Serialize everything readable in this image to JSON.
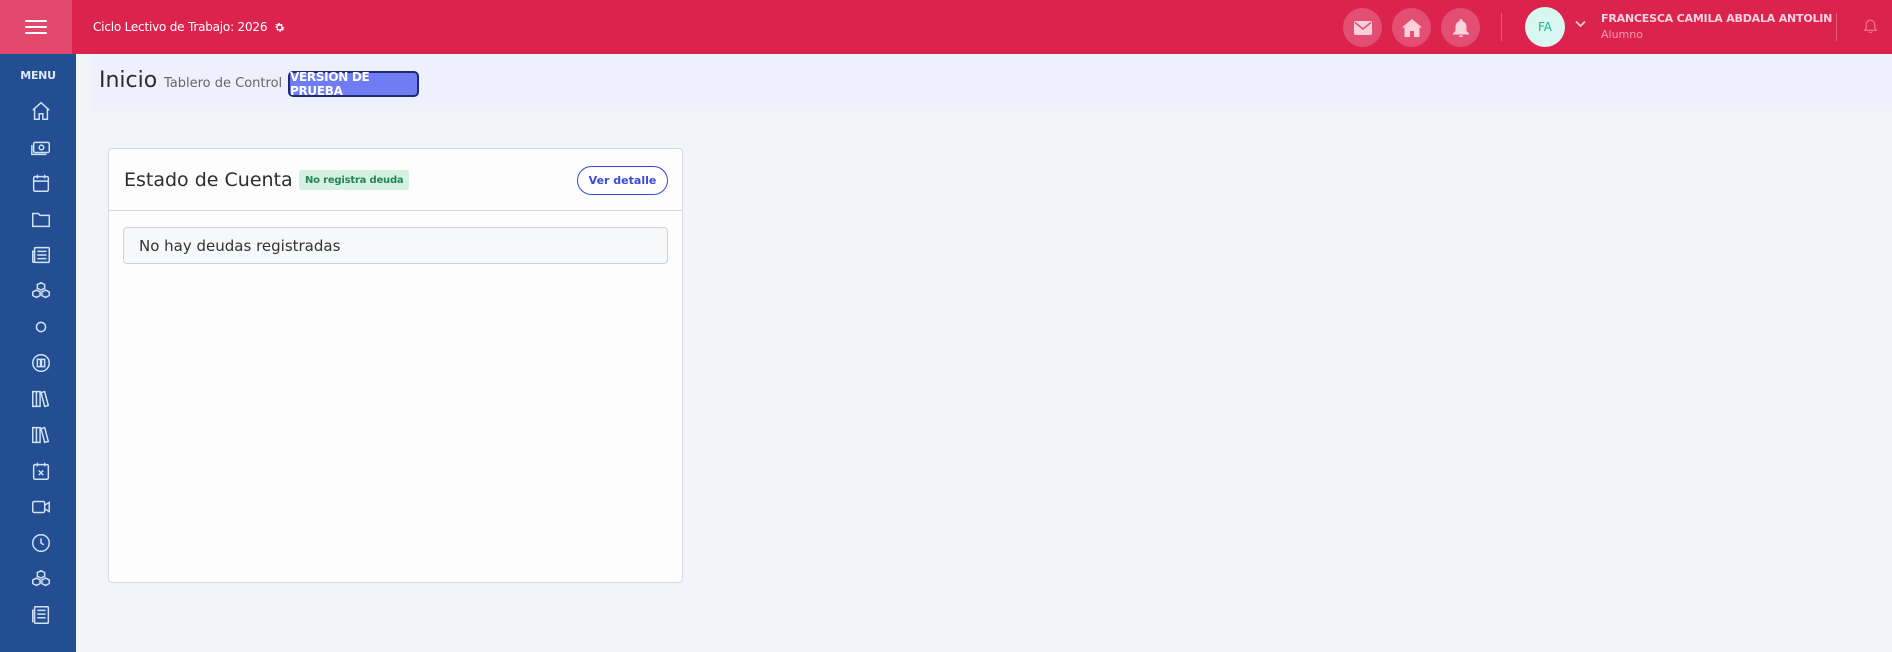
{
  "topbar": {
    "cycle_label": "Ciclo Lectivo de Trabajo: 2026",
    "avatar_initials": "FA",
    "user_name": "FRANCESCA CAMILA ABDALA ANTOLIN",
    "user_role": "Alumno",
    "icons": [
      "envelope-icon",
      "home-icon",
      "bell-icon"
    ]
  },
  "sidebar": {
    "menu_title": "MENU",
    "icons": [
      "home-icon",
      "money-icon",
      "calendar-icon",
      "folder-icon",
      "news-icon",
      "boxes-icon",
      "circle-icon",
      "book-circle-icon",
      "library-icon",
      "library-icon",
      "calendar-x-icon",
      "video-icon",
      "clock-icon",
      "boxes-icon",
      "document-icon"
    ]
  },
  "header": {
    "title": "Inicio",
    "subtitle": "Tablero de Control",
    "badge": "VERSIÓN DE PRUEBA"
  },
  "card": {
    "title": "Estado de Cuenta",
    "status_badge": "No registra deuda",
    "detail_button": "Ver detalle",
    "empty_message": "No hay deudas registradas"
  },
  "colors": {
    "topbar": "#dc234e",
    "sidebar": "#234f92",
    "beta_badge": "#6f7cf3",
    "accent_button": "#3c49d6",
    "success_badge_bg": "#d4f1e2"
  }
}
